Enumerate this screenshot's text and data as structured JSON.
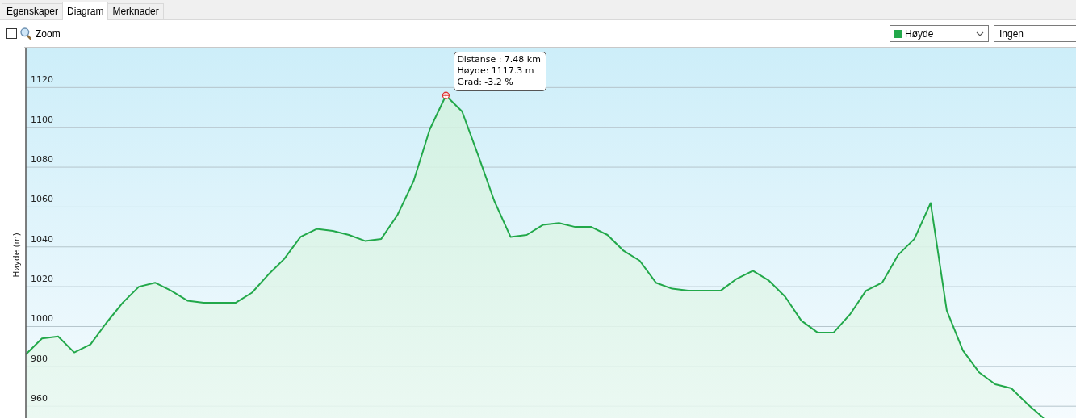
{
  "tabs": [
    {
      "label": "Egenskaper",
      "selected": false
    },
    {
      "label": "Diagram",
      "selected": true
    },
    {
      "label": "Merknader",
      "selected": false
    }
  ],
  "toolbar": {
    "zoom": {
      "label": "Zoom",
      "checked": false
    },
    "second_select": {
      "value": "Ingen"
    }
  },
  "chart": {
    "chart_data": {
      "type": "area",
      "ylabel": "Høyde (m)",
      "ylim": [
        954,
        1140
      ],
      "yticks": [
        960,
        980,
        1000,
        1020,
        1040,
        1060,
        1080,
        1100,
        1120
      ],
      "grid": true,
      "series": [
        {
          "name": "Høyde",
          "color": "#22a84a",
          "values": [
            986,
            994,
            995,
            987,
            991,
            1002,
            1012,
            1020,
            1022,
            1018,
            1013,
            1012,
            1012,
            1012,
            1017,
            1026,
            1034,
            1045,
            1049,
            1048,
            1046,
            1043,
            1044,
            1056,
            1073,
            1099,
            1116,
            1108,
            1086,
            1063,
            1045,
            1046,
            1051,
            1052,
            1050,
            1050,
            1046,
            1038,
            1033,
            1022,
            1019,
            1018,
            1018,
            1018,
            1024,
            1028,
            1023,
            1015,
            1003,
            997,
            997,
            1006,
            1018,
            1022,
            1036,
            1044,
            1062,
            1008,
            988,
            977,
            971,
            969,
            961,
            954
          ]
        }
      ]
    },
    "tooltip": {
      "lines": [
        "Distanse : 7.48 km",
        "Høyde: 1117.3 m",
        "Grad: -3.2 %"
      ]
    }
  }
}
